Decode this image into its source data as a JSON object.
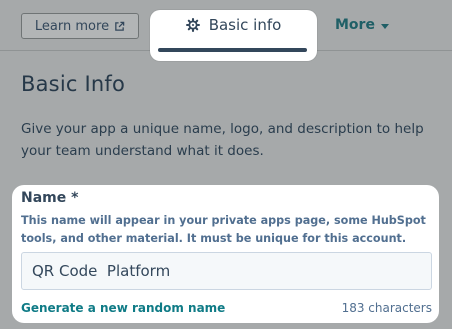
{
  "header": {
    "learn_more_label": "Learn more",
    "learn_more_icon": "external-link-icon",
    "tabs": [
      {
        "label": "Basic info",
        "icon": "gear-icon",
        "active": true
      },
      {
        "label": "More",
        "icon": "caret-down-icon",
        "active": false
      }
    ]
  },
  "page": {
    "title": "Basic Info",
    "description": "Give your app a unique name, logo, and description to help your team understand what it does."
  },
  "name_field": {
    "label": "Name *",
    "help_text": "This name will appear in your private apps page, some HubSpot tools, and other material. It must be unique for this account.",
    "value": "QR Code  Platform",
    "generate_link": "Generate a new random name",
    "char_count": "183 characters"
  },
  "colors": {
    "overlay": "#a6a9aa",
    "text_dark": "#33475b",
    "link_teal": "#0f7b86",
    "help_text": "#516f90"
  }
}
